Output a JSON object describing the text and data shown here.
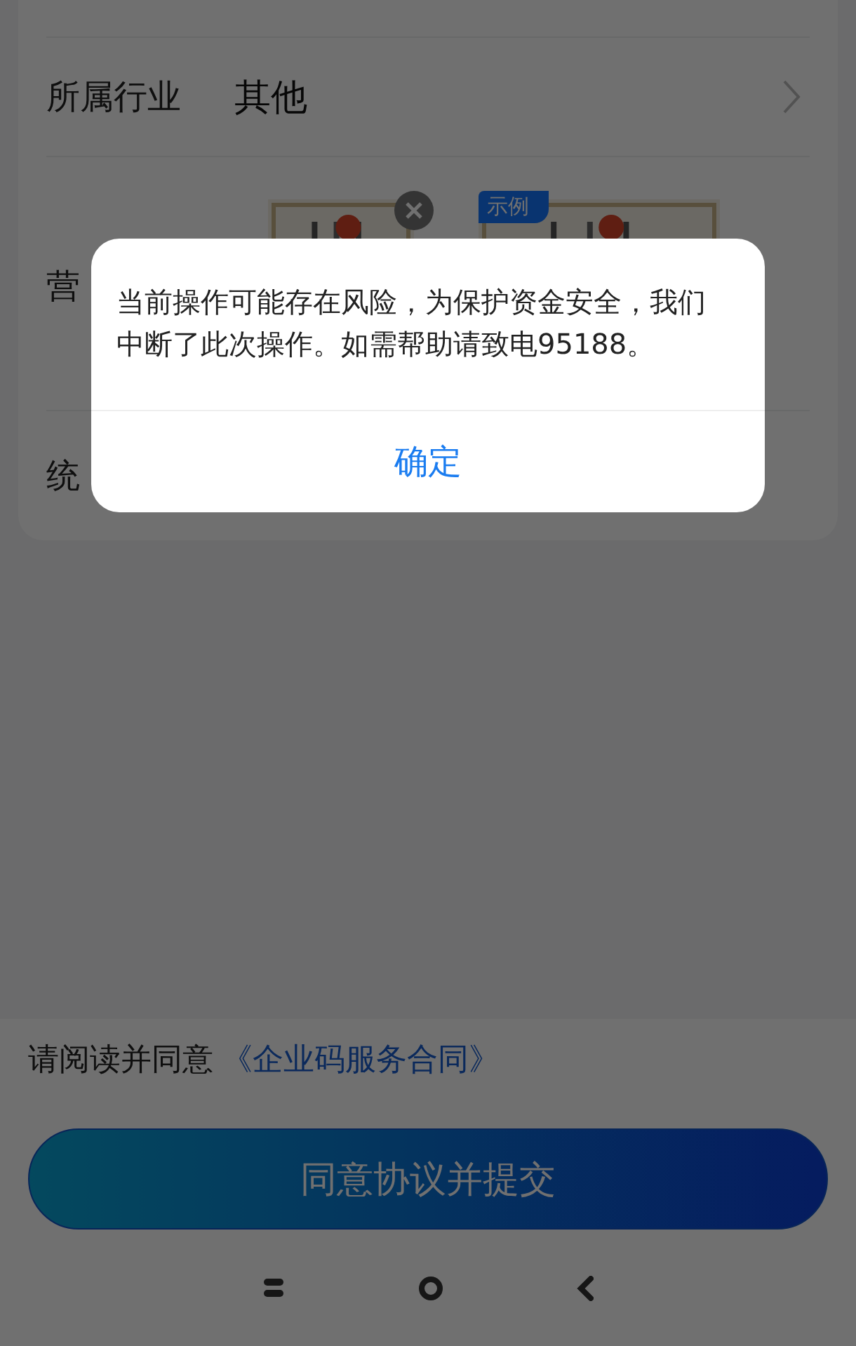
{
  "form": {
    "rows": [
      {
        "kind": "select",
        "label": "所属行业",
        "value": "其他"
      },
      {
        "kind": "upload",
        "label": "营",
        "sample_tag": "示例"
      },
      {
        "kind": "text",
        "label": "统"
      }
    ]
  },
  "agreement": {
    "prefix": "请阅读并同意",
    "link": "《企业码服务合同》"
  },
  "submit_button": "同意协议并提交",
  "dialog": {
    "message": "当前操作可能存在风险，为保护资金安全，我们中断了此次操作。如需帮助请致电95188。",
    "confirm": "确定"
  }
}
